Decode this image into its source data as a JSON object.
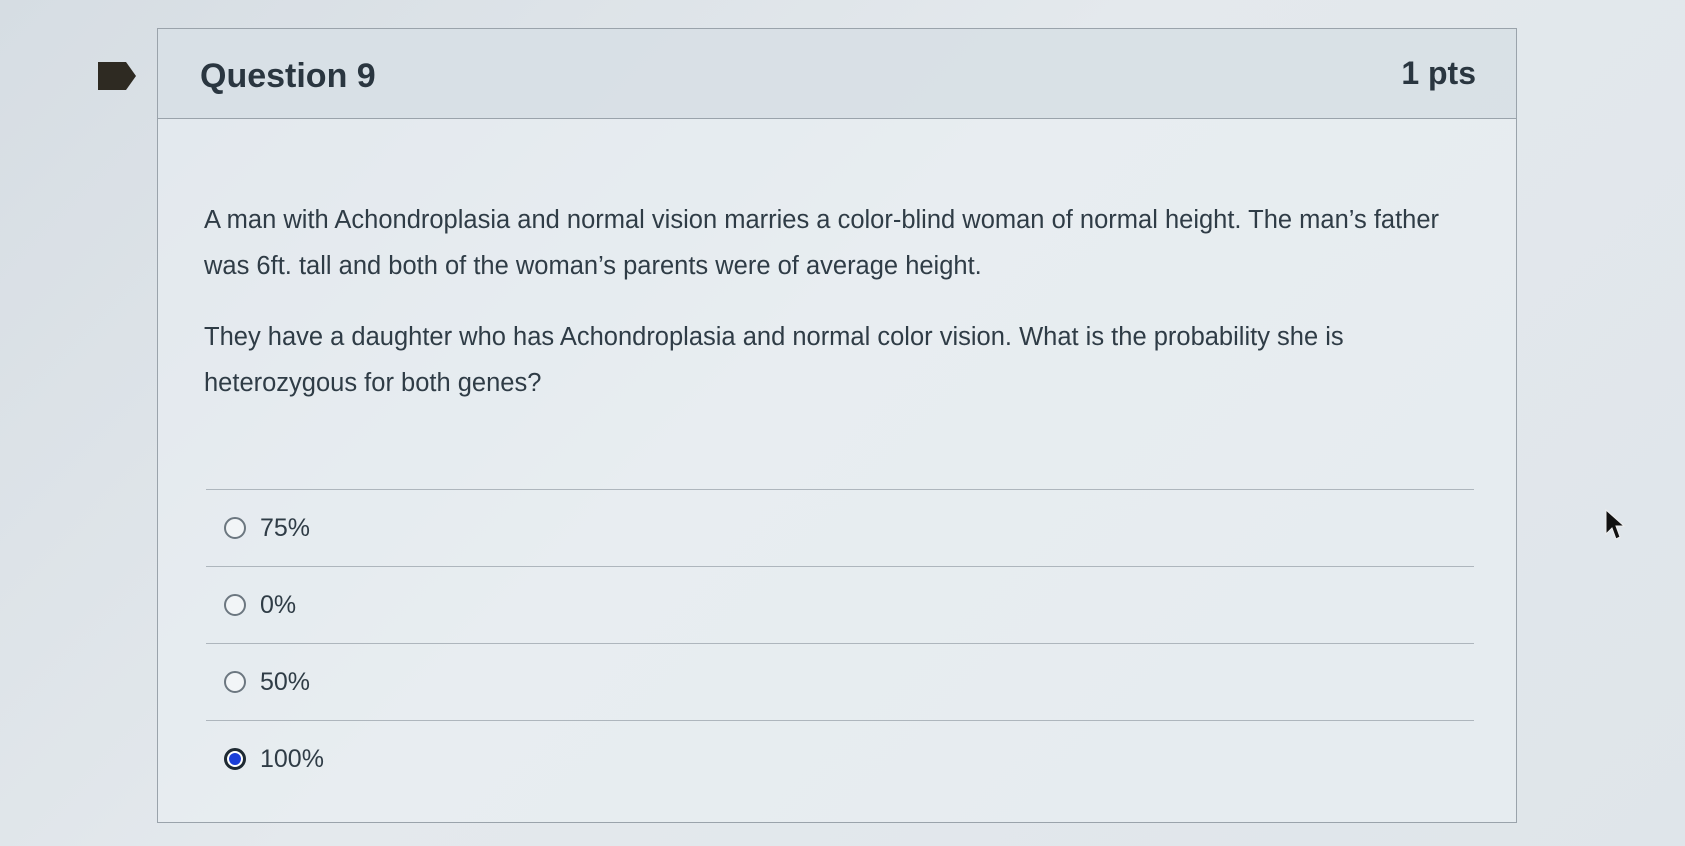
{
  "question": {
    "title": "Question 9",
    "points": "1 pts",
    "paragraphs": [
      "A man with Achondroplasia and normal vision marries a color-blind woman of normal height.  The man’s father was 6ft. tall and both of the woman’s parents were of average height.",
      "They have a daughter who has Achondroplasia and normal color vision.  What is the probability she is heterozygous for both genes?"
    ],
    "answers": [
      {
        "label": "75%",
        "selected": false
      },
      {
        "label": "0%",
        "selected": false
      },
      {
        "label": "50%",
        "selected": false
      },
      {
        "label": "100%",
        "selected": true
      }
    ]
  },
  "colors": {
    "flag": "#2e2a22",
    "selected_radio": "#1c3fd8"
  },
  "icons": {
    "flag": "flag-bookmark-icon",
    "cursor": "mouse-pointer-icon"
  }
}
